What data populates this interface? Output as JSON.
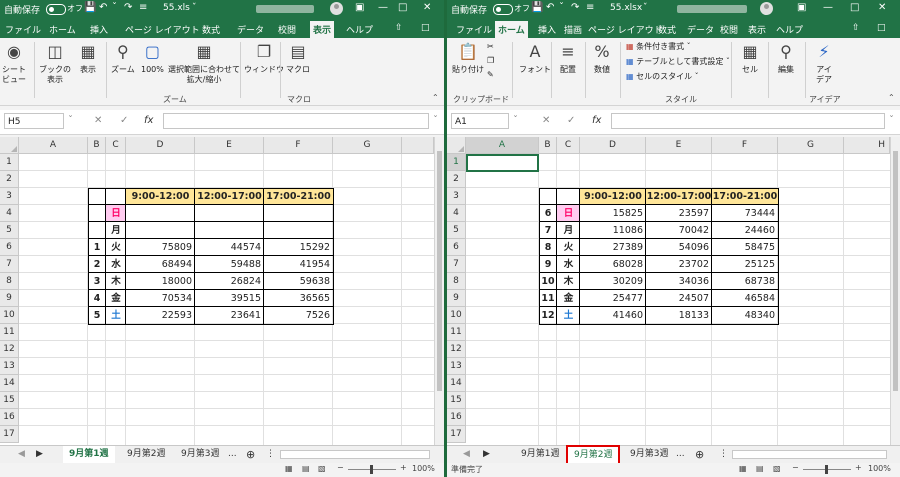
{
  "left": {
    "autosave_label": "自動保存",
    "autosave_state": "オフ",
    "filename": "55.xls",
    "ribbon_tabs": [
      "ファイル",
      "ホーム",
      "挿入",
      "ページ レイアウト",
      "数式",
      "データ",
      "校閲",
      "表示",
      "ヘルプ"
    ],
    "active_ribbon_tab": "表示",
    "ribbon": {
      "sheet_view": [
        "シート",
        "ビュー"
      ],
      "book_view": [
        "ブックの",
        "表示"
      ],
      "display": "表示",
      "zoom": "ズーム",
      "zoom100": "100%",
      "zoom_selection": [
        "選択範囲に合わせて",
        "拡大/縮小"
      ],
      "window": "ウィンドウ",
      "macro": "マクロ",
      "group_zoom": "ズーム",
      "group_macro": "マクロ"
    },
    "name_box": "H5",
    "columns": [
      "A",
      "B",
      "C",
      "D",
      "E",
      "F",
      "G"
    ],
    "rows": [
      "1",
      "2",
      "3",
      "4",
      "5",
      "6",
      "7",
      "8",
      "9",
      "10",
      "11",
      "12",
      "13",
      "14",
      "15",
      "16",
      "17"
    ],
    "table": {
      "headers": [
        "9:00-12:00",
        "12:00-17:00",
        "17:00-21:00"
      ],
      "rows": [
        {
          "b": "",
          "c": "日",
          "d": "",
          "e": "",
          "f": ""
        },
        {
          "b": "",
          "c": "月",
          "d": "",
          "e": "",
          "f": ""
        },
        {
          "b": "1",
          "c": "火",
          "d": "75809",
          "e": "44574",
          "f": "15292"
        },
        {
          "b": "2",
          "c": "水",
          "d": "68494",
          "e": "59488",
          "f": "41954"
        },
        {
          "b": "3",
          "c": "木",
          "d": "18000",
          "e": "26824",
          "f": "59638"
        },
        {
          "b": "4",
          "c": "金",
          "d": "70534",
          "e": "39515",
          "f": "36565"
        },
        {
          "b": "5",
          "c": "土",
          "d": "22593",
          "e": "23641",
          "f": "7526"
        }
      ]
    },
    "sheet_tabs": [
      "9月第1週",
      "9月第2週",
      "9月第3週",
      "..."
    ],
    "active_sheet": "9月第1週",
    "zoom_level": "100%"
  },
  "right": {
    "autosave_label": "自動保存",
    "autosave_state": "オフ",
    "filename": "55.xlsx",
    "ribbon_tabs": [
      "ファイル",
      "ホーム",
      "挿入",
      "描画",
      "ページ レイアウト",
      "数式",
      "データ",
      "校閲",
      "表示",
      "ヘルプ"
    ],
    "active_ribbon_tab": "ホーム",
    "ribbon": {
      "paste": "貼り付け",
      "font": "フォント",
      "align": "配置",
      "number": "数値",
      "cond_format": "条件付き書式",
      "table_format": "テーブルとして書式設定",
      "cell_style": "セルのスタイル",
      "cells": "セル",
      "edit": "編集",
      "ideas": [
        "アイ",
        "デア"
      ],
      "group_clipboard": "クリップボード",
      "group_style": "スタイル",
      "group_ideas": "アイデア"
    },
    "name_box": "A1",
    "columns": [
      "A",
      "B",
      "C",
      "D",
      "E",
      "F",
      "G",
      "H"
    ],
    "rows": [
      "1",
      "2",
      "3",
      "4",
      "5",
      "6",
      "7",
      "8",
      "9",
      "10",
      "11",
      "12",
      "13",
      "14",
      "15",
      "16",
      "17"
    ],
    "table": {
      "headers": [
        "9:00-12:00",
        "12:00-17:00",
        "17:00-21:00"
      ],
      "rows": [
        {
          "b": "6",
          "c": "日",
          "d": "15825",
          "e": "23597",
          "f": "73444"
        },
        {
          "b": "7",
          "c": "月",
          "d": "11086",
          "e": "70042",
          "f": "24460"
        },
        {
          "b": "8",
          "c": "火",
          "d": "27389",
          "e": "54096",
          "f": "58475"
        },
        {
          "b": "9",
          "c": "水",
          "d": "68028",
          "e": "23702",
          "f": "25125"
        },
        {
          "b": "10",
          "c": "木",
          "d": "30209",
          "e": "34036",
          "f": "68738"
        },
        {
          "b": "11",
          "c": "金",
          "d": "25477",
          "e": "24507",
          "f": "46584"
        },
        {
          "b": "12",
          "c": "土",
          "d": "41460",
          "e": "18133",
          "f": "48340"
        }
      ]
    },
    "sheet_tabs": [
      "9月第1週",
      "9月第2週",
      "9月第3週",
      "..."
    ],
    "active_sheet": "9月第2週",
    "status": "準備完了",
    "zoom_level": "100%"
  },
  "colors": {
    "excel_green": "#217346",
    "header_fill": "#ffe699",
    "sunday": "#ff0066",
    "saturday": "#1e78d2",
    "tab_highlight": "#e00000"
  }
}
